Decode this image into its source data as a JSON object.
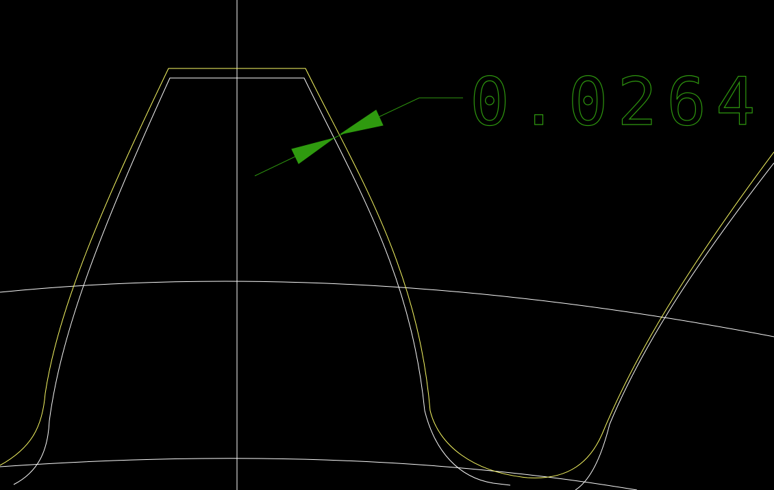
{
  "viewport": {
    "background": "#000000"
  },
  "colors": {
    "white_geometry": "#ffffff",
    "yellow_geometry": "#ffff66",
    "dimension": "#2f9a0f"
  },
  "dimension": {
    "value": "0.0264",
    "type": "aligned-linear-dimension",
    "arrow_icon": "filled-triangle-arrowhead"
  },
  "layers": [
    {
      "name": "reference-profile",
      "color": "white"
    },
    {
      "name": "offset-profile",
      "color": "yellow"
    },
    {
      "name": "centerline-and-circles",
      "color": "white"
    },
    {
      "name": "dimensions",
      "color": "green"
    }
  ]
}
